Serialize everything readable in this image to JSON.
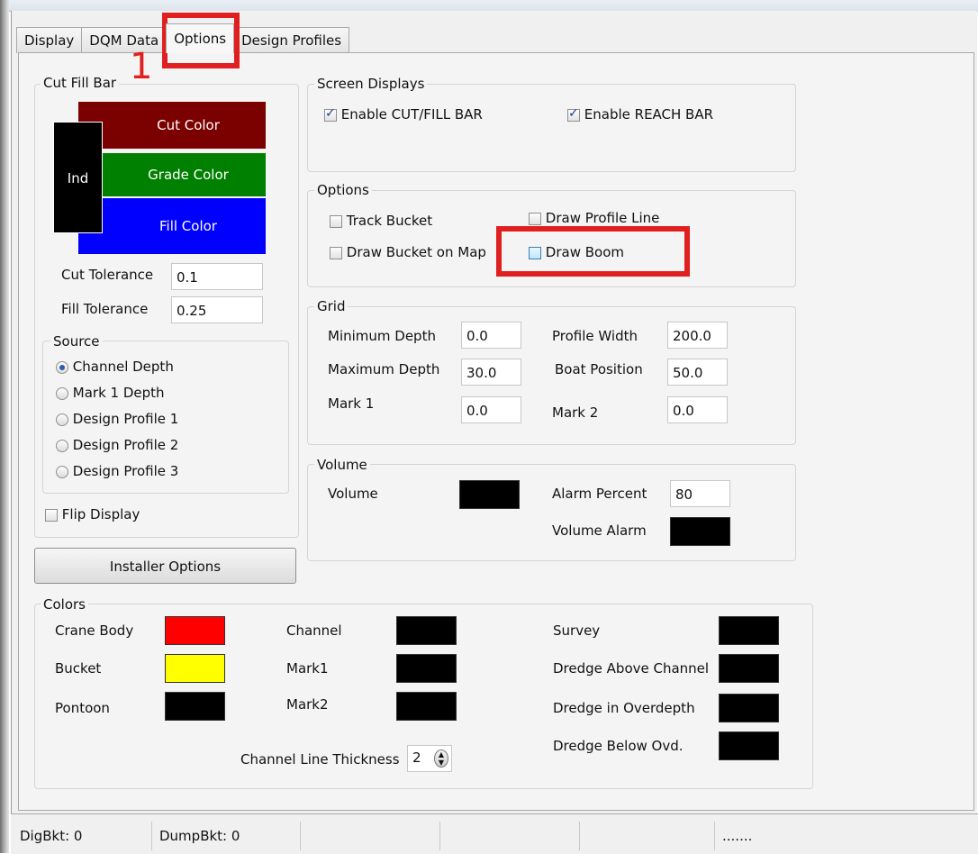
{
  "tabs": [
    "Display",
    "DQM Data",
    "Options",
    "Design Profiles"
  ],
  "annotation_number": "1",
  "cut_fill_bar": {
    "title": "Cut Fill Bar",
    "cut_label": "Cut Color",
    "grade_label": "Grade Color",
    "fill_label": "Fill Color",
    "ind_label": "Ind",
    "cut_tolerance_label": "Cut Tolerance",
    "cut_tolerance_value": "0.1",
    "fill_tolerance_label": "Fill Tolerance",
    "fill_tolerance_value": "0.25",
    "colors": {
      "cut": "#7b0000",
      "grade": "#008000",
      "fill": "#0000ff",
      "ind": "#000000"
    }
  },
  "source": {
    "title": "Source",
    "options": [
      "Channel Depth",
      "Mark 1 Depth",
      "Design Profile 1",
      "Design Profile 2",
      "Design Profile 3"
    ],
    "selected": "Channel Depth"
  },
  "flip_display_label": "Flip Display",
  "installer_options_label": "Installer Options",
  "screen_displays": {
    "title": "Screen Displays",
    "enable_cut_fill_label": "Enable CUT/FILL BAR",
    "enable_reach_label": "Enable REACH BAR"
  },
  "options": {
    "title": "Options",
    "track_bucket_label": "Track Bucket",
    "draw_profile_line_label": "Draw Profile Line",
    "draw_bucket_on_map_label": "Draw Bucket on Map",
    "draw_boom_label": "Draw Boom"
  },
  "grid": {
    "title": "Grid",
    "min_depth_label": "Minimum Depth",
    "min_depth_value": "0.0",
    "max_depth_label": "Maximum Depth",
    "max_depth_value": "30.0",
    "mark1_label": "Mark 1",
    "mark1_value": "0.0",
    "profile_width_label": "Profile Width",
    "profile_width_value": "200.0",
    "boat_position_label": "Boat Position",
    "boat_position_value": "50.0",
    "mark2_label": "Mark 2",
    "mark2_value": "0.0"
  },
  "volume": {
    "title": "Volume",
    "volume_label": "Volume",
    "alarm_percent_label": "Alarm Percent",
    "alarm_percent_value": "80",
    "volume_alarm_label": "Volume Alarm"
  },
  "colors": {
    "title": "Colors",
    "crane_body_label": "Crane Body",
    "bucket_label": "Bucket",
    "pontoon_label": "Pontoon",
    "channel_label": "Channel",
    "mark1_label": "Mark1",
    "mark2_label": "Mark2",
    "survey_label": "Survey",
    "dredge_above_label": "Dredge Above Channel",
    "dredge_overdepth_label": "Dredge in Overdepth",
    "dredge_below_label": "Dredge Below Ovd.",
    "channel_line_thickness_label": "Channel Line Thickness",
    "channel_line_thickness_value": "2",
    "swatches": {
      "crane_body": "#ff0000",
      "bucket": "#ffff00",
      "black": "#000000"
    }
  },
  "status_bar": {
    "digbkt": "DigBkt: 0",
    "dumpbkt": "DumpBkt: 0",
    "dots": "......."
  }
}
